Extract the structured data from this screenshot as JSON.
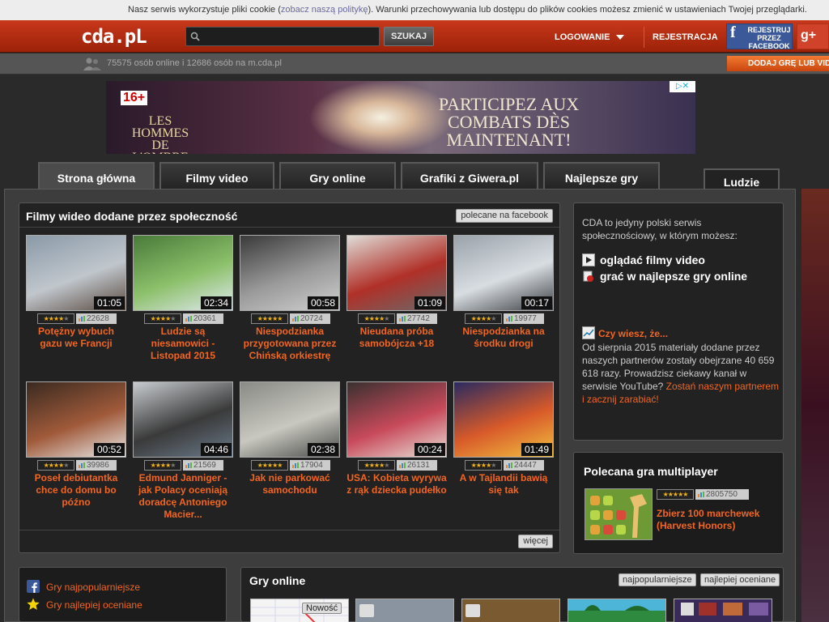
{
  "cookie": {
    "before": "Nasz serwis wykorzystuje pliki cookie (",
    "link": "zobacz naszą politykę",
    "after": "). Warunki przechowywania lub dostępu do plików cookies możesz zmienić w ustawieniach Twojej przeglądarki."
  },
  "header": {
    "logo": "cda.pL",
    "search_placeholder": "",
    "search_button": "SZUKAJ",
    "login": "LOGOWANIE",
    "register": "REJESTRACJA",
    "fb_register": "REJESTRUJ PRZEZ FACEBOOK",
    "gplus": "g+"
  },
  "subbar": {
    "online": "75575 osób online i 12686 osób na m.cda.pl",
    "add_game": "DODAJ GRĘ LUB VID"
  },
  "banner": {
    "age": "16+",
    "game": "LES HOMMES DE L'OMBRE",
    "claim": "PARTICIPEZ AUX COMBATS DÈS MAINTENANT!"
  },
  "tabs": [
    "Strona główna",
    "Filmy video",
    "Gry online",
    "Grafiki z Giwera.pl",
    "Najlepsze gry"
  ],
  "tab_right": "Ludzie",
  "videos": {
    "title": "Filmy wideo dodane przez społeczność",
    "fb_button": "polecane na facebook",
    "more_button": "więcej",
    "items": [
      {
        "duration": "01:05",
        "rating": 4,
        "views": "22628",
        "title": "Potężny wybuch gazu we Francji"
      },
      {
        "duration": "02:34",
        "rating": 4,
        "views": "20361",
        "title": "Ludzie są niesamowici - Listopad 2015"
      },
      {
        "duration": "00:58",
        "rating": 5,
        "views": "20724",
        "title": "Niespodzianka przygotowana przez Chińską orkiestrę"
      },
      {
        "duration": "01:09",
        "rating": 4,
        "views": "27742",
        "title": "Nieudana próba samobójcza +18"
      },
      {
        "duration": "00:17",
        "rating": 4,
        "views": "19977",
        "title": "Niespodzianka na środku drogi"
      },
      {
        "duration": "00:52",
        "rating": 4,
        "views": "39986",
        "title": "Poseł debiutantka chce do domu bo późno"
      },
      {
        "duration": "04:46",
        "rating": 4,
        "views": "21569",
        "title": "Edmund Janniger - jak Polacy oceniają doradcę Antoniego Macier..."
      },
      {
        "duration": "02:38",
        "rating": 5,
        "views": "17904",
        "title": "Jak nie parkować samochodu"
      },
      {
        "duration": "00:24",
        "rating": 4,
        "views": "26131",
        "title": "USA: Kobieta wyrywa z rąk dziecka pudełko"
      },
      {
        "duration": "01:49",
        "rating": 4,
        "views": "24447",
        "title": "A w Tajlandii bawią się tak"
      }
    ]
  },
  "info": {
    "intro": "CDA to jedyny polski serwis społecznościowy, w którym możesz:",
    "item1": "oglądać filmy video",
    "item2": "grać w najlepsze gry online",
    "didyou_title": "Czy wiesz, że...",
    "didyou_text": "Od sierpnia 2015 materiały dodane przez naszych partnerów zostały obejrzane 40 659 618 razy. Prowadzisz ciekawy kanał w serwisie YouTube?",
    "didyou_link": "Zostań naszym partnerem i zacznij zarabiać!"
  },
  "featured_game": {
    "title": "Polecana gra multiplayer",
    "rating": 5,
    "views": "2805750",
    "name": "Zbierz 100 marchewek (Harvest Honors)"
  },
  "left_links": [
    "Gry najpopularniejsze",
    "Gry najlepiej oceniane"
  ],
  "games": {
    "title": "Gry online",
    "btn_popular": "najpopularniejsze",
    "btn_best": "najlepiej oceniane",
    "new_badge": "Nowość"
  },
  "colors": {
    "accent": "#f26522",
    "header_red": "#c8381b",
    "star": "#f2b318"
  }
}
